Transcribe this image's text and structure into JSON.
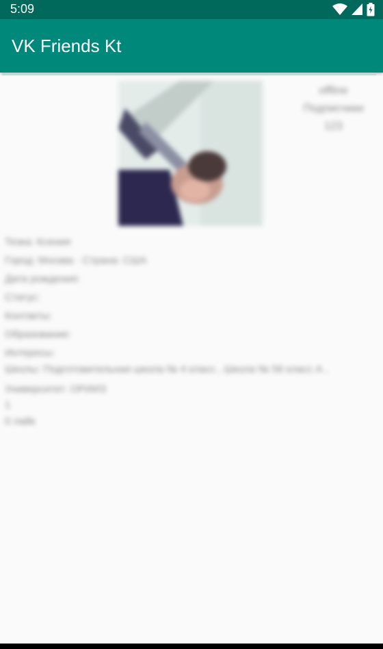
{
  "status_bar": {
    "time": "5:09",
    "icons": [
      "wifi-icon",
      "signal-icon",
      "battery-icon"
    ]
  },
  "app_bar": {
    "title": "VK Friends Kt"
  },
  "profile": {
    "status": "offline",
    "side_info_line2": "Подписчики",
    "side_info_line3": "123"
  },
  "details": [
    "Тезка: Ксения",
    "Город: Москва · Страна: США",
    "Дата рождения:",
    "Статус:",
    "Контакты:",
    "Образование:",
    "Интересы:",
    "Школы: Подготовительная школа № 4 класс ,  Школа № 56 класс А ,",
    "Университет: ОРИИЗ",
    "1",
    "0 лайк"
  ],
  "colors": {
    "status_bar": "#00695c",
    "app_bar": "#00897b",
    "background": "#fafafa"
  }
}
